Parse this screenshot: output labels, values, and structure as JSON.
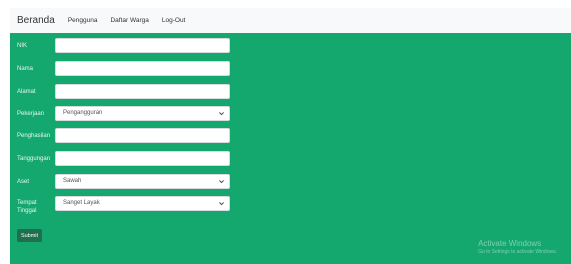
{
  "nav": {
    "brand": "Beranda",
    "links": [
      "Pengguna",
      "Daftar Warga",
      "Log-Out"
    ]
  },
  "form": {
    "nik": {
      "label": "NIK",
      "value": ""
    },
    "nama": {
      "label": "Nama",
      "value": ""
    },
    "alamat": {
      "label": "Alamat",
      "value": ""
    },
    "pekerjaan": {
      "label": "Pekerjaan",
      "selected": "Pengangguran"
    },
    "penghasilan": {
      "label": "Penghasilan",
      "value": ""
    },
    "tanggungan": {
      "label": "Tanggungan",
      "value": ""
    },
    "aset": {
      "label": "Aset",
      "selected": "Sawah"
    },
    "tempat_tinggal": {
      "label_line1": "Tempat",
      "label_line2": "Tinggal",
      "selected": "Sanget Layak"
    },
    "submit_label": "Submit"
  },
  "watermark": {
    "title": "Activate Windows",
    "subtitle": "Go to Settings to activate Windows."
  },
  "colors": {
    "main_bg": "#14a86e",
    "navbar_bg": "#f8f9fa",
    "submit_bg": "#1f6f4c"
  }
}
